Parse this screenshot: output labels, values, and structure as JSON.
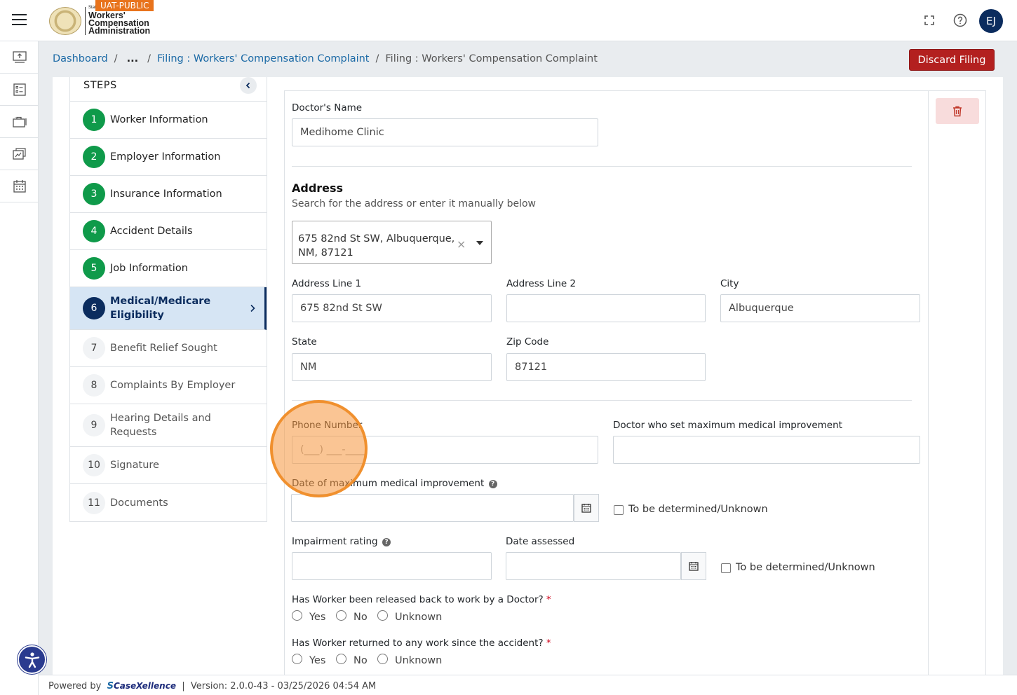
{
  "header": {
    "logo": {
      "state": "State",
      "line1": "Workers'",
      "line2": "Compensation",
      "line3": "Administration"
    },
    "env_badge": "UAT-PUBLIC",
    "user_initials": "EJ",
    "icons": [
      "menu-icon",
      "fullscreen-icon",
      "help-icon"
    ]
  },
  "breadcrumb": {
    "items": [
      "Dashboard",
      "...",
      "Filing : Workers' Compensation Complaint",
      "Filing : Workers' Compensation Complaint"
    ],
    "separator": "/"
  },
  "actions": {
    "discard_label": "Discard Filing"
  },
  "rail": {
    "icons": [
      "upload-icon",
      "checklist-icon",
      "briefcase-icon",
      "document-icon",
      "calendar-icon"
    ]
  },
  "steps": {
    "title": "STEPS",
    "items": [
      {
        "num": "1",
        "label": "Worker Information",
        "state": "done"
      },
      {
        "num": "2",
        "label": "Employer Information",
        "state": "done"
      },
      {
        "num": "3",
        "label": "Insurance Information",
        "state": "done"
      },
      {
        "num": "4",
        "label": "Accident Details",
        "state": "done"
      },
      {
        "num": "5",
        "label": "Job Information",
        "state": "done"
      },
      {
        "num": "6",
        "label": "Medical/Medicare Eligibility",
        "state": "active"
      },
      {
        "num": "7",
        "label": "Benefit Relief Sought",
        "state": "todo"
      },
      {
        "num": "8",
        "label": "Complaints By Employer",
        "state": "todo"
      },
      {
        "num": "9",
        "label": "Hearing Details and Requests",
        "state": "todo"
      },
      {
        "num": "10",
        "label": "Signature",
        "state": "todo"
      },
      {
        "num": "11",
        "label": "Documents",
        "state": "todo"
      }
    ]
  },
  "form": {
    "doctor_name_label": "Doctor's Name",
    "doctor_name_value": "Medihome Clinic",
    "address_title": "Address",
    "address_subtitle": "Search for the address or enter it manually below",
    "address_search_value": "675 82nd St SW, Albuquerque, NM, 87121",
    "address_line1_label": "Address Line 1",
    "address_line1_value": "675 82nd St SW",
    "address_line2_label": "Address Line 2",
    "address_line2_value": "",
    "city_label": "City",
    "city_value": "Albuquerque",
    "state_label": "State",
    "state_value": "NM",
    "zip_label": "Zip Code",
    "zip_value": "87121",
    "phone_label": "Phone Number",
    "phone_placeholder": "(___) ___-____",
    "mmi_doctor_label": "Doctor who set maximum medical improvement",
    "mmi_doctor_value": "",
    "mmi_date_label": "Date of maximum medical improvement",
    "mmi_date_value": "",
    "tbd_label": "To be determined/Unknown",
    "impairment_label": "Impairment rating",
    "impairment_value": "",
    "date_assessed_label": "Date assessed",
    "date_assessed_value": "",
    "released_question": "Has Worker been released back to work by a Doctor?",
    "returned_question": "Has Worker returned to any work since the accident?",
    "required_mark": "*",
    "options": [
      "Yes",
      "No",
      "Unknown"
    ]
  },
  "footer": {
    "powered_by": "Powered by",
    "brand": "CaseXellence",
    "brand_mark": "S",
    "divider": "|",
    "version": "Version: 2.0.0-43 - 03/25/2026 04:54 AM"
  }
}
